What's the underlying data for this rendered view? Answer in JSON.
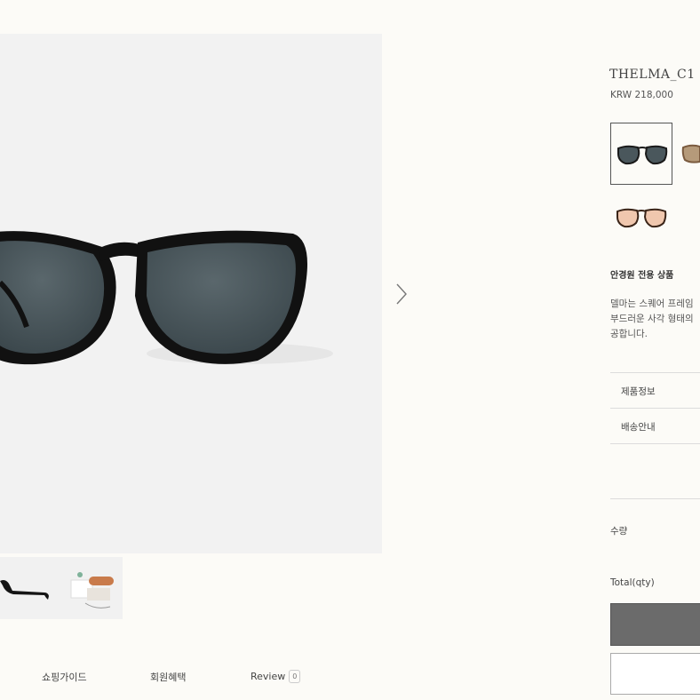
{
  "product": {
    "name": "THELMA_C1",
    "price": "KRW 218,000",
    "optical_label": "안경원 전용 상품",
    "description_lines": [
      "델마는 스퀘어 프레임",
      "부드러운 사각 형태의",
      "공합니다."
    ]
  },
  "swatches": [
    {
      "name": "black-grey-lens",
      "frame_color": "#1a1a1a",
      "lens_color": "#4a575c"
    },
    {
      "name": "tortoise-brown-lens",
      "frame_color": "#7a5a3e",
      "lens_color": "#b59a7a"
    },
    {
      "name": "tortoise-peach-lens",
      "frame_color": "#3a2418",
      "lens_color": "#f0c7ae"
    }
  ],
  "accordion": {
    "product_info": "제품정보",
    "shipping": "배송안내"
  },
  "purchase": {
    "qty_label": "수량",
    "total_label": "Total(qty)"
  },
  "tabs": {
    "shopping_guide": "쇼핑가이드",
    "member_benefits": "회원혜택",
    "review": "Review",
    "review_count": "0"
  },
  "colors": {
    "background": "#fcfbf7",
    "hero_background": "#f2f2f2",
    "buy_button": "#6b6b6b"
  },
  "icons": [
    "chevron-right-icon"
  ]
}
